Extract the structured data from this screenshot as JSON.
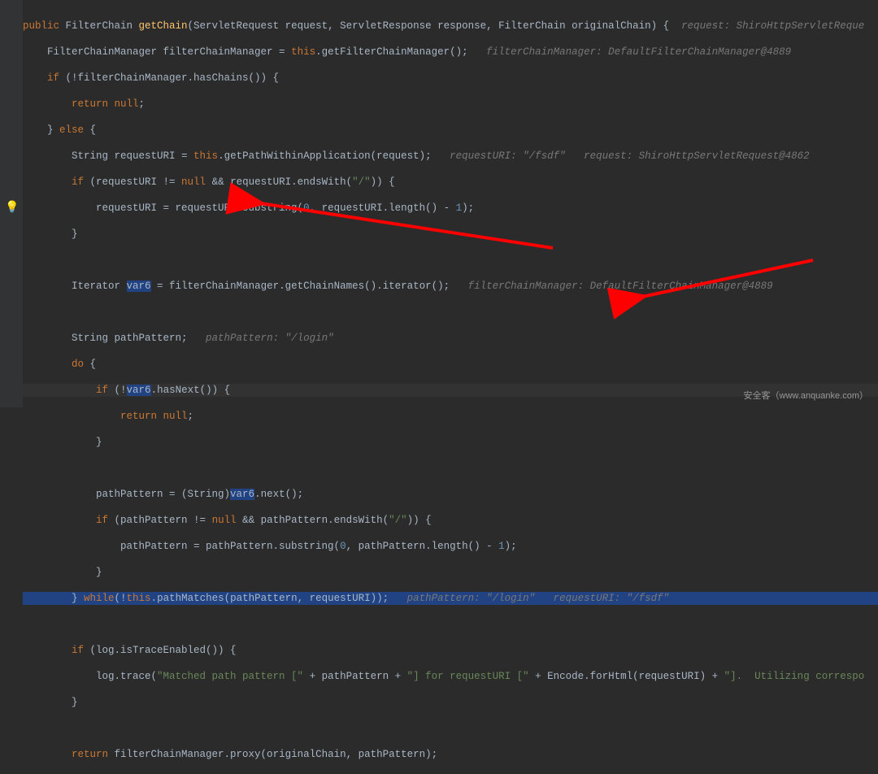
{
  "code": {
    "l1": {
      "a": "public ",
      "b": "FilterChain ",
      "c": "getChain",
      "d": "(ServletRequest request, ServletResponse response, FilterChain originalChain) {",
      "h": "  request: ShiroHttpServletReque"
    },
    "l2": {
      "a": "    FilterChainManager filterChainManager = ",
      "b": "this",
      "c": ".getFilterChainManager();",
      "h": "   filterChainManager: DefaultFilterChainManager@4889"
    },
    "l3": {
      "a": "    if ",
      "b": "(!filterChainManager.hasChains()) {"
    },
    "l4": {
      "a": "        return null",
      ";": ";"
    },
    "l5": {
      "a": "    } ",
      "b": "else ",
      "c": "{"
    },
    "l6": {
      "a": "        String requestURI = ",
      "b": "this",
      "c": ".getPathWithinApplication(request);",
      "h": "   requestURI: \"/fsdf\"   request: ShiroHttpServletRequest@4862"
    },
    "l7": {
      "a": "        if ",
      "b": "(requestURI != ",
      "c": "null ",
      "d": "&& requestURI.endsWith(",
      "e": "\"/\"",
      "f": ")) {"
    },
    "l8": {
      "a": "            requestURI = requestURI.substring(",
      "b": "0",
      "c": ", requestURI.length() - ",
      "d": "1",
      "e": ");"
    },
    "l9": {
      "a": "        }"
    },
    "l10": {
      "a": ""
    },
    "l11": {
      "a": "        Iterator ",
      "b": "var6",
      "c": " = filterChainManager.getChainNames().iterator();",
      "h": "   filterChainManager: DefaultFilterChainManager@4889"
    },
    "l12": {
      "a": ""
    },
    "l13": {
      "a": "        String pathPattern;",
      "h": "   pathPattern: \"/login\""
    },
    "l14": {
      "a": "        do ",
      "b": "{"
    },
    "l15": {
      "a": "            if ",
      "b": "(!",
      "c": "var6",
      "d": ".hasNext()) {"
    },
    "l16": {
      "a": "                return null",
      ";": ";"
    },
    "l17": {
      "a": "            }"
    },
    "l18": {
      "a": ""
    },
    "l19": {
      "a": "            pathPattern = (String)",
      "b": "var6",
      "c": ".next();"
    },
    "l20": {
      "a": "            if ",
      "b": "(pathPattern != ",
      "c": "null ",
      "d": "&& pathPattern.endsWith(",
      "e": "\"/\"",
      "f": ")) {"
    },
    "l21": {
      "a": "                pathPattern = pathPattern.substring(",
      "b": "0",
      "c": ", pathPattern.length() - ",
      "d": "1",
      "e": ");"
    },
    "l22": {
      "a": "            }"
    },
    "l23": {
      "a": "        } ",
      "b": "while",
      "c": "(!",
      "d": "this",
      "e": ".pathMatches(pathPattern, requestURI));",
      "h": "   pathPattern: \"/login\"   requestURI: \"/fsdf\""
    },
    "l24": {
      "a": ""
    },
    "l25": {
      "a": "        if ",
      "b": "(log.isTraceEnabled()) {"
    },
    "l26": {
      "a": "            log.trace(",
      "b": "\"Matched path pattern [\"",
      "c": " + pathPattern + ",
      "d": "\"] for requestURI [\"",
      "e": " + Encode.forHtml(requestURI) + ",
      "f": "\"].  Utilizing correspo"
    },
    "l27": {
      "a": "        }"
    },
    "l28": {
      "a": ""
    },
    "l29": {
      "a": "        return ",
      "b": "filterChainManager.proxy(originalChain, pathPattern);"
    }
  },
  "gutter": {
    "bulb": "💡"
  },
  "watermark": "安全客（www.anquanke.com）"
}
